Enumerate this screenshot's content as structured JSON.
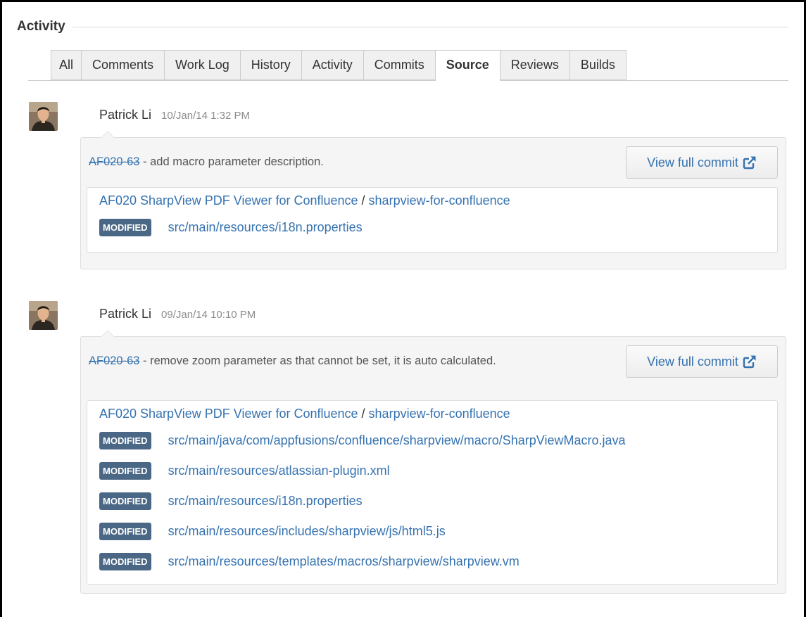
{
  "section": {
    "title": "Activity"
  },
  "tabs": [
    {
      "label": "All"
    },
    {
      "label": "Comments"
    },
    {
      "label": "Work Log"
    },
    {
      "label": "History"
    },
    {
      "label": "Activity"
    },
    {
      "label": "Commits"
    },
    {
      "label": "Source",
      "active": true
    },
    {
      "label": "Reviews"
    },
    {
      "label": "Builds"
    }
  ],
  "entries": [
    {
      "author": "Patrick Li",
      "timestamp": "10/Jan/14 1:32 PM",
      "issue_key": "AF020-63",
      "message": " - add macro parameter description.",
      "view_button": "View full commit",
      "repo": "AF020 SharpView PDF Viewer for Confluence",
      "separator": " / ",
      "branch": "sharpview-for-confluence",
      "files": [
        {
          "status": "MODIFIED",
          "path": "src/main/resources/i18n.properties"
        }
      ]
    },
    {
      "author": "Patrick Li",
      "timestamp": "09/Jan/14 10:10 PM",
      "issue_key": "AF020-63",
      "message": " - remove zoom parameter as that cannot be set, it is auto calculated.",
      "view_button": "View full commit",
      "repo": "AF020 SharpView PDF Viewer for Confluence",
      "separator": " / ",
      "branch": "sharpview-for-confluence",
      "files": [
        {
          "status": "MODIFIED",
          "path": "src/main/java/com/appfusions/confluence/sharpview/macro/SharpViewMacro.java"
        },
        {
          "status": "MODIFIED",
          "path": "src/main/resources/atlassian-plugin.xml"
        },
        {
          "status": "MODIFIED",
          "path": "src/main/resources/i18n.properties"
        },
        {
          "status": "MODIFIED",
          "path": "src/main/resources/includes/sharpview/js/html5.js"
        },
        {
          "status": "MODIFIED",
          "path": "src/main/resources/templates/macros/sharpview/sharpview.vm"
        }
      ]
    }
  ],
  "colors": {
    "link": "#3572b0",
    "badge": "#4a6785",
    "box_bg": "#f5f5f5"
  },
  "icons": {
    "external_link": "external-link-icon",
    "avatar": "user-avatar"
  }
}
